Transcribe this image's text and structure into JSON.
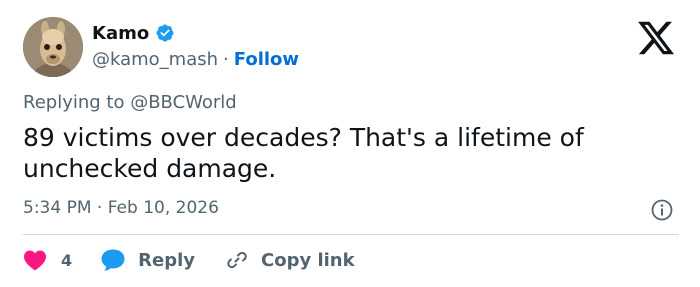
{
  "author": {
    "name": "Kamo",
    "handle": "@kamo_mash",
    "separator": "·",
    "follow_label": "Follow"
  },
  "reply_context": "Replying to @BBCWorld",
  "tweet": {
    "text": "89 victims over decades? That's a lifetime of unchecked damage.",
    "timestamp": "5:34 PM · Feb 10, 2026"
  },
  "actions": {
    "like_count": "4",
    "reply_label": "Reply",
    "copy_link_label": "Copy link"
  },
  "icons": {
    "verified": "verified-badge-icon",
    "logo": "x-logo-icon",
    "info": "info-icon",
    "like": "heart-icon",
    "reply": "speech-bubble-icon",
    "copy": "link-icon"
  },
  "colors": {
    "verified": "#1d9bf0",
    "follow": "#006fd6",
    "like": "#f91880",
    "reply": "#1d9bf0",
    "secondary_text": "#536471"
  }
}
